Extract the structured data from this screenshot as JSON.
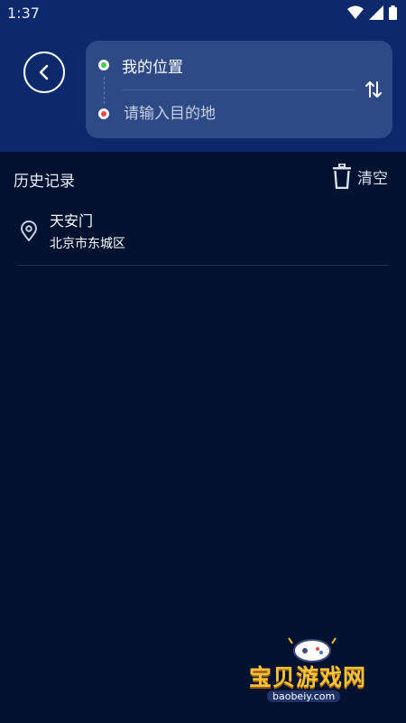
{
  "status_bar": {
    "time": "1:37",
    "icons": [
      "wifi-icon",
      "signal-icon",
      "battery-icon"
    ]
  },
  "header": {
    "back_icon": "chevron-left-icon",
    "origin": {
      "label": "我的位置",
      "dot_color": "#3ecf4a"
    },
    "destination": {
      "placeholder": "请输入目的地",
      "value": "",
      "dot_color": "#f0464e"
    },
    "swap_icon": "swap-vertical-icon"
  },
  "history": {
    "title": "历史记录",
    "clear_label": "清空",
    "clear_icon": "trash-icon",
    "items": [
      {
        "name": "天安门",
        "address": "北京市东城区",
        "icon": "location-pin-icon"
      }
    ]
  },
  "watermark": {
    "text": "宝贝游戏网",
    "url": "baobeiy.com"
  },
  "colors": {
    "header_bg": "#0c2a6b",
    "card_bg": "#2e4a86",
    "page_bg": "#001230"
  }
}
